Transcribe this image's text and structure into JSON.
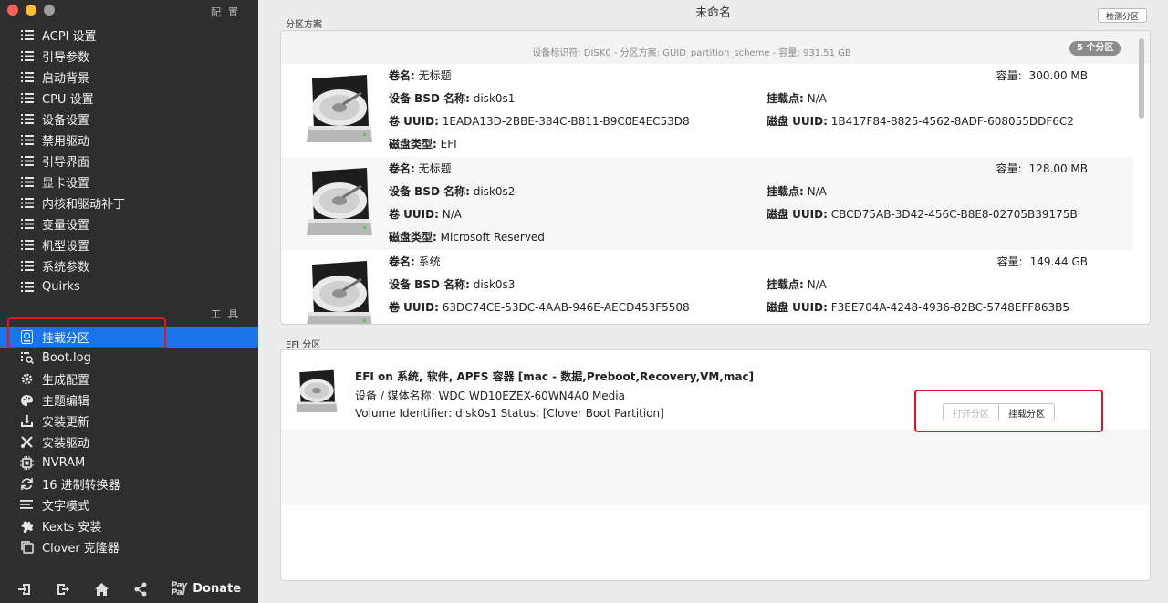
{
  "window": {
    "title": "未命名"
  },
  "colors": {
    "selected": "#1a73e8",
    "highlight_box": "#e3141e",
    "sidebar_bg": "#2e2e2e"
  },
  "sidebar": {
    "config_header": "配置",
    "config_items": [
      {
        "label": "ACPI 设置",
        "icon": "list-icon"
      },
      {
        "label": "引导参数",
        "icon": "list-icon"
      },
      {
        "label": "启动背景",
        "icon": "list-icon"
      },
      {
        "label": "CPU 设置",
        "icon": "list-icon"
      },
      {
        "label": "设备设置",
        "icon": "list-icon"
      },
      {
        "label": "禁用驱动",
        "icon": "list-icon"
      },
      {
        "label": "引导界面",
        "icon": "list-icon"
      },
      {
        "label": "显卡设置",
        "icon": "list-icon"
      },
      {
        "label": "内核和驱动补丁",
        "icon": "list-icon"
      },
      {
        "label": "变量设置",
        "icon": "list-icon"
      },
      {
        "label": "机型设置",
        "icon": "list-icon"
      },
      {
        "label": "系统参数",
        "icon": "list-icon"
      },
      {
        "label": "Quirks",
        "icon": "list-icon"
      }
    ],
    "tools_header": "工具",
    "tool_items": [
      {
        "label": "挂载分区",
        "icon": "disk-icon",
        "selected": true
      },
      {
        "label": "Boot.log",
        "icon": "log-search-icon"
      },
      {
        "label": "生成配置",
        "icon": "gear-icon"
      },
      {
        "label": "主题编辑",
        "icon": "palette-icon"
      },
      {
        "label": "安装更新",
        "icon": "download-icon"
      },
      {
        "label": "安装驱动",
        "icon": "tools-icon"
      },
      {
        "label": "NVRAM",
        "icon": "chip-icon"
      },
      {
        "label": "16 进制转换器",
        "icon": "refresh-icon"
      },
      {
        "label": "文字模式",
        "icon": "text-lines-icon"
      },
      {
        "label": "Kexts 安装",
        "icon": "puzzle-icon"
      },
      {
        "label": "Clover 克隆器",
        "icon": "copy-icon"
      }
    ],
    "bottom": {
      "icons": [
        "import-icon",
        "export-icon",
        "home-icon",
        "share-icon"
      ],
      "paypal_top": "Pay",
      "paypal_bottom": "Pal",
      "donate": "Donate"
    }
  },
  "toolbar": {
    "detect_label": "检测分区"
  },
  "partition_scheme": {
    "label": "分区方案",
    "summary": "设备标识符: DISK0 - 分区方案: GUID_partition_scheme - 容量: 931.51 GB",
    "count_badge": "5 个分区",
    "partitions": [
      {
        "volume_label": "卷名:",
        "volume": "无标题",
        "capacity_label": "容量:",
        "capacity": "300.00 MB",
        "bsd_label": "设备 BSD 名称:",
        "bsd": "disk0s1",
        "mount_label": "挂载点:",
        "mount": "N/A",
        "uuid_label": "卷 UUID:",
        "uuid": "1EADA13D-2BBE-384C-B811-B9C0E4EC53D8",
        "disk_uuid_label": "磁盘 UUID:",
        "disk_uuid": "1B417F84-8825-4562-8ADF-608055DDF6C2",
        "type_label": "磁盘类型:",
        "type": "EFI"
      },
      {
        "volume_label": "卷名:",
        "volume": "无标题",
        "capacity_label": "容量:",
        "capacity": "128.00 MB",
        "bsd_label": "设备 BSD 名称:",
        "bsd": "disk0s2",
        "mount_label": "挂载点:",
        "mount": "N/A",
        "uuid_label": "卷 UUID:",
        "uuid": "N/A",
        "disk_uuid_label": "磁盘 UUID:",
        "disk_uuid": "CBCD75AB-3D42-456C-B8E8-02705B39175B",
        "type_label": "磁盘类型:",
        "type": "Microsoft Reserved"
      },
      {
        "volume_label": "卷名:",
        "volume": "系统",
        "capacity_label": "容量:",
        "capacity": "149.44 GB",
        "bsd_label": "设备 BSD 名称:",
        "bsd": "disk0s3",
        "mount_label": "挂载点:",
        "mount": "N/A",
        "uuid_label": "卷 UUID:",
        "uuid": "63DC74CE-53DC-4AAB-946E-AECD453F5508",
        "disk_uuid_label": "磁盘 UUID:",
        "disk_uuid": "F3EE704A-4248-4936-82BC-5748EFF863B5"
      }
    ]
  },
  "efi_section": {
    "label": "EFI 分区",
    "entry": {
      "title": "EFI on 系统, 软件, APFS 容器 [mac - 数据,Preboot,Recovery,VM,mac]",
      "device": "设备 / 媒体名称: WDC WD10EZEX-60WN4A0 Media",
      "identifier": "Volume Identifier: disk0s1 Status: [Clover Boot Partition]"
    },
    "open_button": "打开分区",
    "mount_button": "挂载分区"
  }
}
